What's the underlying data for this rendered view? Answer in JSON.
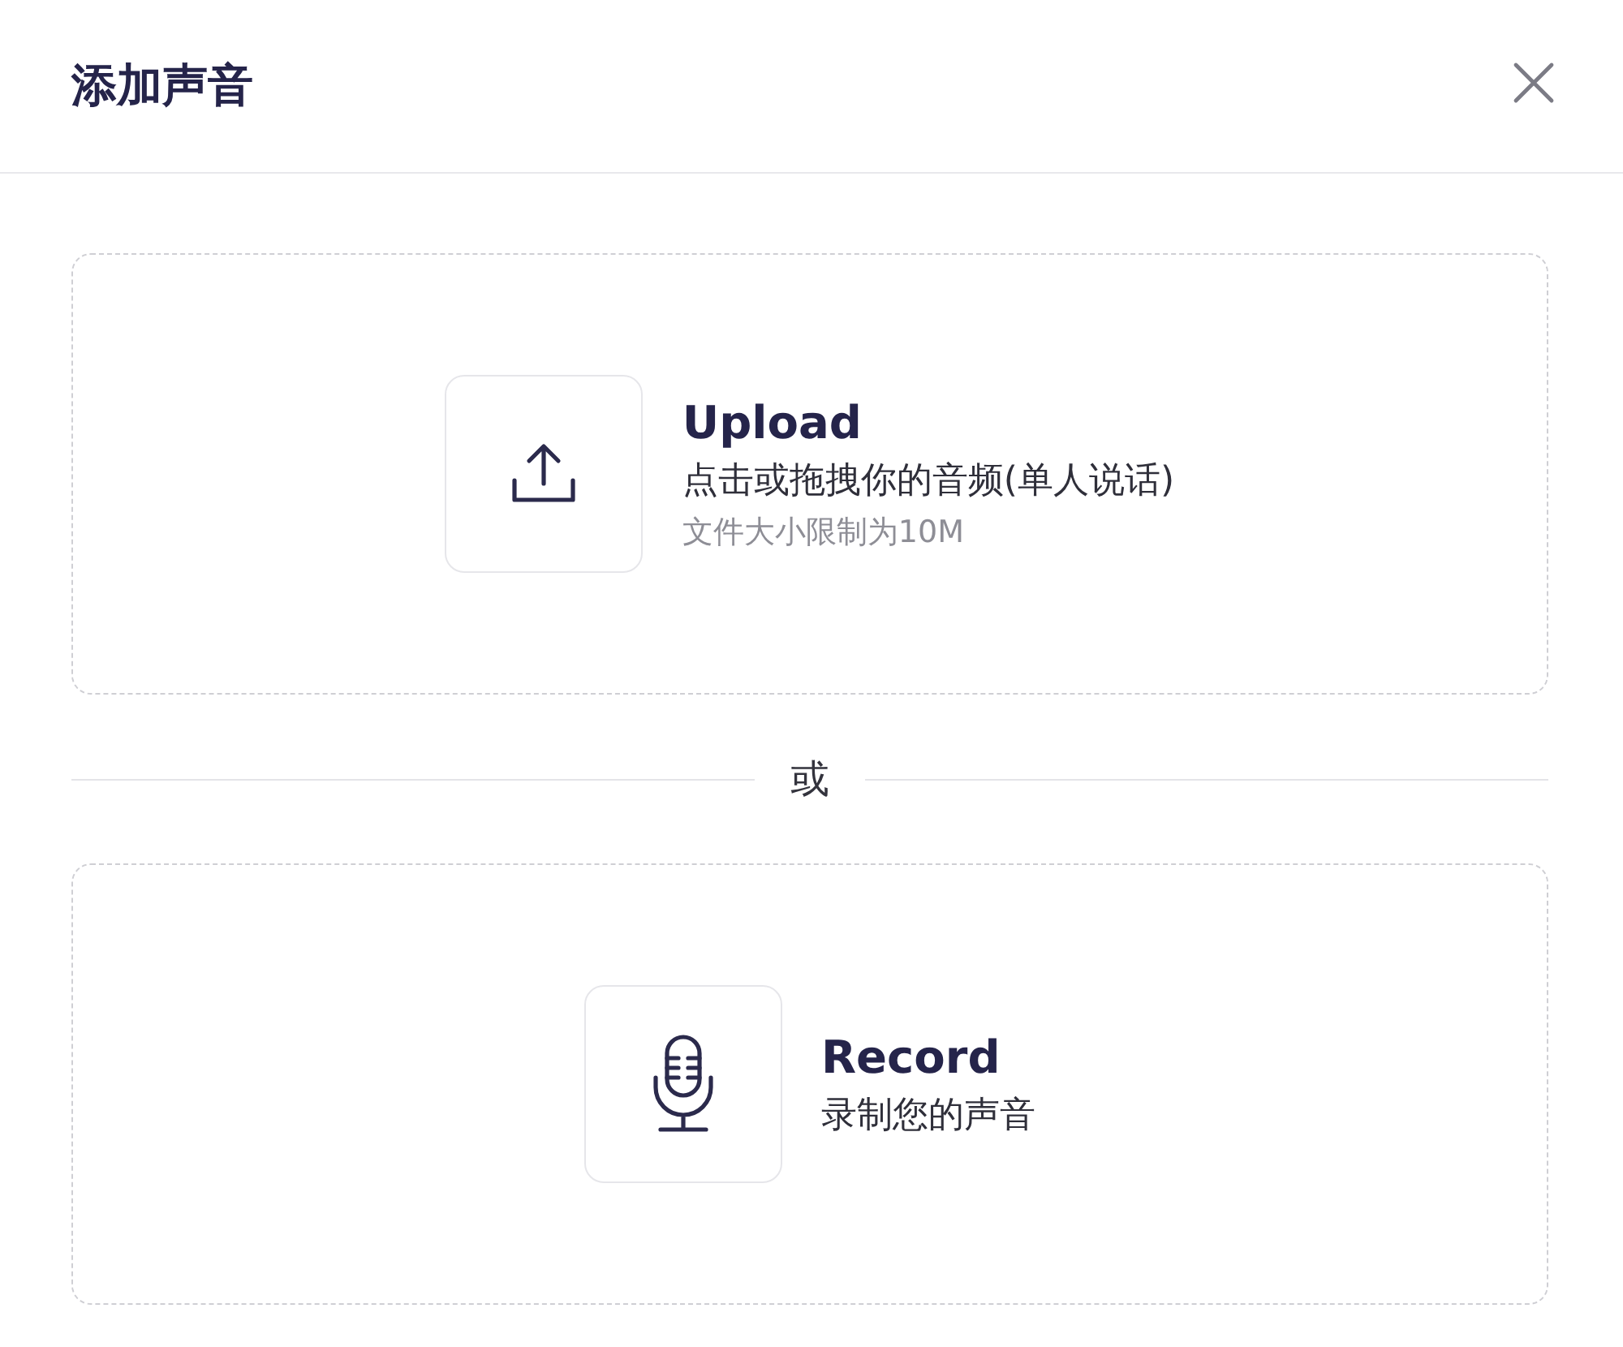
{
  "dialog": {
    "title": "添加声音"
  },
  "options": [
    {
      "kind": "upload",
      "title": "Upload",
      "description": "点击或拖拽你的音频(单人说话)",
      "hint": "文件大小限制为10M"
    },
    {
      "kind": "record",
      "title": "Record",
      "description": "录制您的声音"
    }
  ],
  "separator": "或"
}
